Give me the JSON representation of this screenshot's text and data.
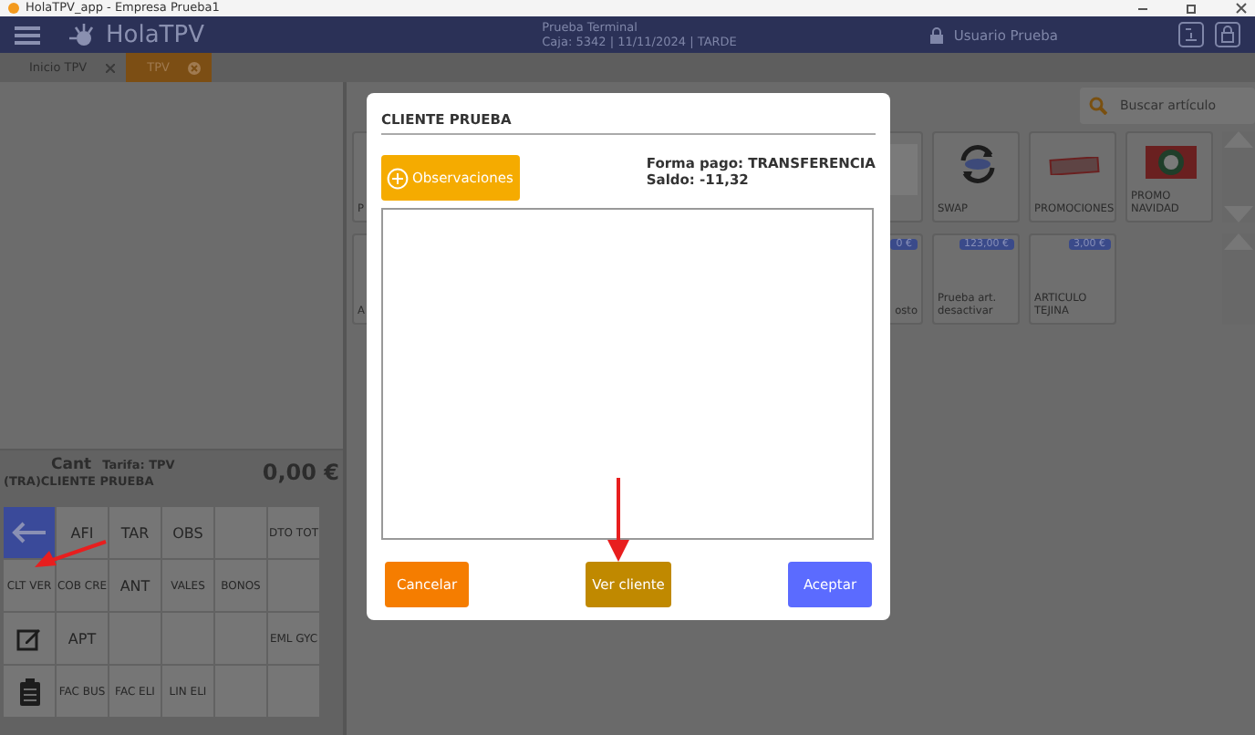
{
  "window": {
    "title": "HolaTPV_app - Empresa Prueba1"
  },
  "header": {
    "logo": "HolaTPV",
    "terminal": "Prueba Terminal",
    "session": "Caja: 5342 | 11/11/2024 | TARDE",
    "user": "Usuario Prueba"
  },
  "tabs": [
    {
      "label": "Inicio TPV",
      "selected": false
    },
    {
      "label": "TPV",
      "selected": true
    }
  ],
  "search": {
    "placeholder": "Buscar artículo"
  },
  "products": [
    [
      {
        "kind": "clipped",
        "label": "P"
      },
      {
        "kind": "empty"
      },
      {
        "kind": "empty"
      },
      {
        "kind": "empty"
      },
      {
        "kind": "empty"
      },
      {
        "kind": "image"
      },
      {
        "kind": "swap",
        "label": "SWAP"
      },
      {
        "kind": "promo",
        "label": "PROMOCIONES"
      },
      {
        "kind": "xmas",
        "label": "PROMO NAVIDAD"
      }
    ],
    [
      {
        "kind": "clipped",
        "label": "A"
      },
      {
        "kind": "empty"
      },
      {
        "kind": "empty"
      },
      {
        "kind": "empty"
      },
      {
        "kind": "empty"
      },
      {
        "kind": "clipped",
        "price": "0 €",
        "label": "osto"
      },
      {
        "kind": "text",
        "price": "123,00 €",
        "label": "Prueba art. desactivar"
      },
      {
        "kind": "text",
        "price": "3,00 €",
        "label": "ARTICULO TEJINA"
      }
    ]
  ],
  "ticket": {
    "qty_label": "Cant",
    "rate": "Tarifa: TPV",
    "client": "(TRA)CLIENTE PRUEBA",
    "total": "0,00 €"
  },
  "keypad": [
    [
      {
        "kind": "back"
      },
      {
        "kind": "text",
        "label": "AFI"
      },
      {
        "kind": "text",
        "label": "TAR"
      },
      {
        "kind": "text",
        "label": "OBS"
      },
      {
        "kind": "empty"
      },
      {
        "kind": "small",
        "label": "DTO TOT"
      }
    ],
    [
      {
        "kind": "small",
        "label": "CLT VER"
      },
      {
        "kind": "small",
        "label": "COB CRE"
      },
      {
        "kind": "text",
        "label": "ANT"
      },
      {
        "kind": "small",
        "label": "VALES"
      },
      {
        "kind": "small",
        "label": "BONOS"
      },
      {
        "kind": "empty"
      }
    ],
    [
      {
        "kind": "edit"
      },
      {
        "kind": "text",
        "label": "APT"
      },
      {
        "kind": "empty"
      },
      {
        "kind": "empty"
      },
      {
        "kind": "empty"
      },
      {
        "kind": "small",
        "label": "EML GYC"
      }
    ],
    [
      {
        "kind": "clipboard"
      },
      {
        "kind": "small",
        "label": "FAC BUS"
      },
      {
        "kind": "small",
        "label": "FAC ELI"
      },
      {
        "kind": "small",
        "label": "LIN ELI"
      },
      {
        "kind": "empty"
      },
      {
        "kind": "empty"
      }
    ]
  ],
  "dialog": {
    "title": "CLIENTE PRUEBA",
    "notes_button": "Observaciones",
    "payment": "Forma pago: TRANSFERENCIA",
    "balance": "Saldo: -11,32",
    "buttons": [
      {
        "kind": "cancel",
        "label": "Cancelar"
      },
      {
        "kind": "view",
        "label": "Ver cliente"
      },
      {
        "kind": "accept",
        "label": "Aceptar"
      }
    ]
  }
}
